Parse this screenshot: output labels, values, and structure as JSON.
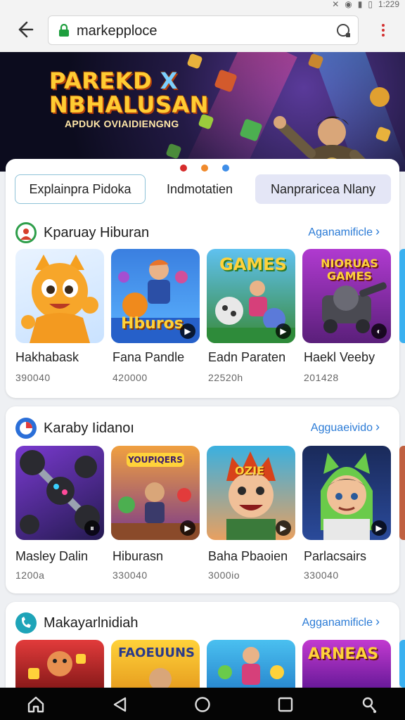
{
  "status_bar": {
    "time": "1:229"
  },
  "browser": {
    "url": "markepploce"
  },
  "hero": {
    "title_line1": "PAREKD",
    "title_x": "X",
    "title_line2": "NBHALUSAN",
    "subtitle": "APDUK OVIAIDIENGNG",
    "carousel_dots": [
      "#d62c2c",
      "#f08a2c",
      "#3f8ee8"
    ]
  },
  "chips": [
    "Explainpra Pidoka",
    "Indmotatien",
    "Nanpraricea Nlany"
  ],
  "sections": [
    {
      "title": "Kparuay Hiburan",
      "more": "Aganamificle",
      "icon_color": "#2e9e4a",
      "items": [
        {
          "title": "Hakhabask",
          "count": "390040",
          "art": "cat-mascot"
        },
        {
          "title": "Fana Pandle",
          "count": "420000",
          "art": "Hburos"
        },
        {
          "title": "Eadn Paraten",
          "count": "22520h",
          "art": "GAMES"
        },
        {
          "title": "Haekl Veeby",
          "count": "201428",
          "art": "NIORUAS GAMES"
        }
      ]
    },
    {
      "title": "Karaby Iidanoı",
      "more": "Agguaeivido",
      "icon_color": "#2b6fd8",
      "items": [
        {
          "title": "Masley Dalin",
          "count": "1200а",
          "art": "orbs"
        },
        {
          "title": "Hiburasn",
          "count": "330040",
          "art": "YOUPIQERS"
        },
        {
          "title": "Baha Pbaoien",
          "count": "3000io",
          "art": "OZIE"
        },
        {
          "title": "Parlacsairs",
          "count": "330040",
          "art": "hooded-kid"
        }
      ]
    },
    {
      "title": "Makayarlnidiah",
      "more": "Agganamificle",
      "icon_color": "#1ea4b8",
      "items": [
        {
          "title": "",
          "count": "",
          "art": ""
        },
        {
          "title": "",
          "count": "",
          "art": "FAOEUUNS"
        },
        {
          "title": "",
          "count": "",
          "art": ""
        },
        {
          "title": "",
          "count": "",
          "art": "ARNEAS"
        }
      ]
    }
  ]
}
